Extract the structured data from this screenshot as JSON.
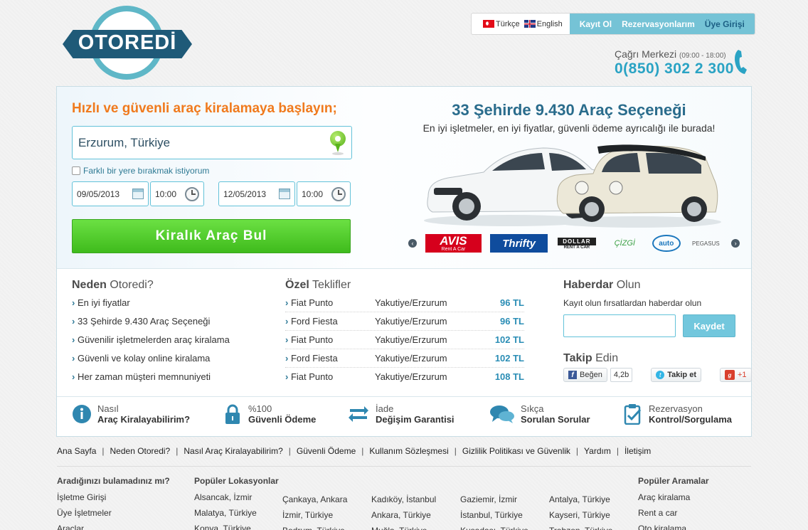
{
  "logo": {
    "text": "OTOREDİ"
  },
  "lang": {
    "tr": "Türkçe",
    "en": "English"
  },
  "usernav": {
    "register": "Kayıt Ol",
    "reservations": "Rezervasyonlarım",
    "login": "Üye Girişi"
  },
  "callcenter": {
    "label": "Çağrı Merkezi",
    "hours": "(09:00 - 18:00)",
    "number": "0(850) 302 2 300"
  },
  "search": {
    "heading": "Hızlı ve güvenli araç kiralamaya başlayın;",
    "location": "Erzurum, Türkiye",
    "drop_label": "Farklı bir yere bırakmak istiyorum",
    "pickup_date": "09/05/2013",
    "pickup_time": "10:00",
    "return_date": "12/05/2013",
    "return_time": "10:00",
    "button": "Kiralık Araç Bul"
  },
  "hero": {
    "title": "33 Şehirde 9.430 Araç Seçeneği",
    "subtitle": "En iyi işletmeler, en iyi fiyatlar, güvenli ödeme ayrıcalığı ile burada!",
    "brands": [
      "AVIS",
      "Thrifty",
      "DOLLAR",
      "ÇİZGİ",
      "auto",
      "PEGASUS"
    ],
    "avis_sub": "Rent A Car",
    "dollar_sub": "RENT A CAR"
  },
  "why": {
    "title_bold": "Neden",
    "title_rest": "Otoredi?",
    "items": [
      "En iyi fiyatlar",
      "33 Şehirde 9.430 Araç Seçeneği",
      "Güvenilir işletmelerden araç kiralama",
      "Güvenli ve kolay online kiralama",
      "Her zaman müşteri memnuniyeti"
    ]
  },
  "offers": {
    "title_bold": "Özel",
    "title_rest": "Teklifler",
    "rows": [
      {
        "car": "Fiat Punto",
        "loc": "Yakutiye/Erzurum",
        "price": "96 TL"
      },
      {
        "car": "Ford Fiesta",
        "loc": "Yakutiye/Erzurum",
        "price": "96 TL"
      },
      {
        "car": "Fiat Punto",
        "loc": "Yakutiye/Erzurum",
        "price": "102 TL"
      },
      {
        "car": "Ford Fiesta",
        "loc": "Yakutiye/Erzurum",
        "price": "102 TL"
      },
      {
        "car": "Fiat Punto",
        "loc": "Yakutiye/Erzurum",
        "price": "108 TL"
      }
    ]
  },
  "newsletter": {
    "title_bold": "Haberdar",
    "title_rest": "Olun",
    "text": "Kayıt olun fırsatlardan haberdar olun",
    "placeholder": "",
    "button": "Kaydet"
  },
  "follow": {
    "title_bold": "Takip",
    "title_rest": "Edin",
    "fb_label": "Beğen",
    "fb_count": "4,2b",
    "tw_label": "Takip et",
    "gplus_label": "+1"
  },
  "features": [
    {
      "line1": "Nasıl",
      "line2": "Araç Kiralayabilirim?"
    },
    {
      "line1": "%100",
      "line2": "Güvenli Ödeme"
    },
    {
      "line1": "İade",
      "line2": "Değişim Garantisi"
    },
    {
      "line1": "Sıkça",
      "line2": "Sorulan Sorular"
    },
    {
      "line1": "Rezervasyon",
      "line2": "Kontrol/Sorgulama"
    }
  ],
  "footnav": [
    "Ana Sayfa",
    "Neden Otoredi?",
    "Nasıl Araç Kiralayabilirim?",
    "Güvenli Ödeme",
    "Kullanım Sözleşmesi",
    "Gizlilik Politikası ve Güvenlik",
    "Yardım",
    "İletişim"
  ],
  "footer": {
    "col1": {
      "title": "Aradığınızı bulamadınız mı?",
      "items": [
        "İşletme Girişi",
        "Üye İşletmeler",
        "Araçlar"
      ]
    },
    "popular_locations_title": "Popüler Lokasyonlar",
    "loc_cols": [
      [
        "Alsancak, İzmir",
        "Malatya, Türkiye",
        "Konya, Türkiye"
      ],
      [
        "Çankaya, Ankara",
        "İzmir, Türkiye",
        "Bodrum, Türkiye"
      ],
      [
        "Kadıköy, İstanbul",
        "Ankara, Türkiye",
        "Muğla, Türkiye"
      ],
      [
        "Gaziemir, İzmir",
        "İstanbul, Türkiye",
        "Kuşadası, Türkiye"
      ],
      [
        "Antalya, Türkiye",
        "Kayseri, Türkiye",
        "Trabzon, Türkiye"
      ]
    ],
    "popular_searches": {
      "title": "Popüler Aramalar",
      "items": [
        "Araç kiralama",
        "Rent a car",
        "Oto kiralama"
      ]
    }
  },
  "colors": {
    "accent": "#75c3d6",
    "orange": "#f07a1d",
    "green": "#4ccb2a",
    "dark_blue": "#1f5a78"
  }
}
